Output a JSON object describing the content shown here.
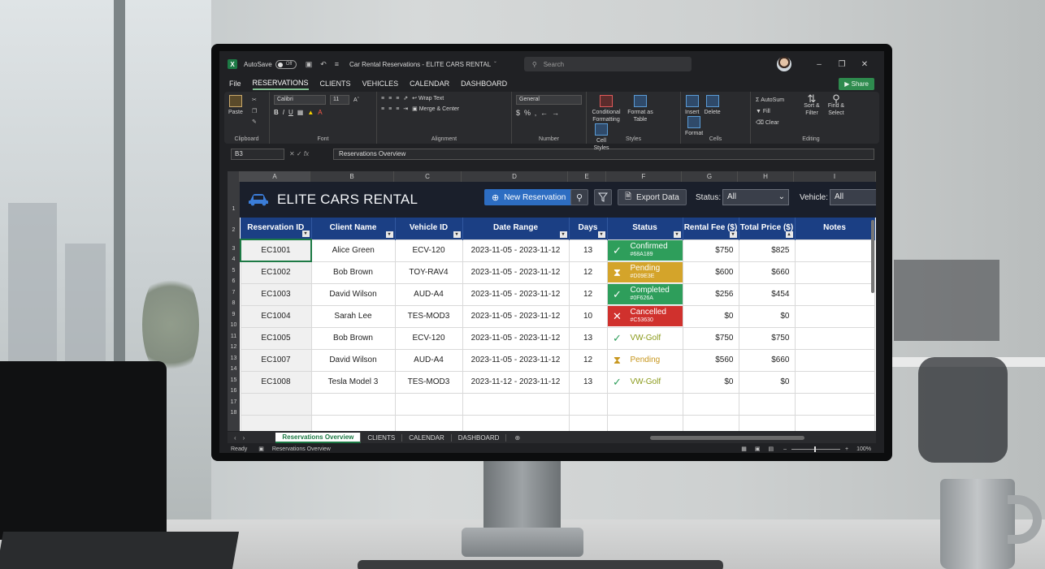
{
  "app": {
    "autosave_label": "AutoSave",
    "autosave_state": "Off",
    "doc_title": "Car Rental Reservations - ELITE CARS RENTAL",
    "search_placeholder": "Search"
  },
  "menu": {
    "tabs": [
      "File",
      "RESERVATIONS",
      "CLIENTS",
      "VEHICLES",
      "CALENDAR",
      "DASHBOARD"
    ],
    "share_label": "Share"
  },
  "ribbon": {
    "clipboard": {
      "paste": "Paste",
      "label": "Clipboard"
    },
    "font": {
      "name": "Calibri",
      "size": "11",
      "label": "Font"
    },
    "alignment": {
      "wrap": "Wrap Text",
      "merge": "Merge & Center",
      "label": "Alignment"
    },
    "number": {
      "format": "General",
      "label": "Number"
    },
    "styles": {
      "conditional": "Conditional Formatting",
      "table": "Format as Table",
      "cell": "Cell Styles",
      "label": "Styles"
    },
    "cells": {
      "insert": "Insert",
      "delete": "Delete",
      "format": "Format",
      "label": "Cells"
    },
    "editing": {
      "autosum": "AutoSum",
      "fill": "Fill",
      "clear": "Clear",
      "sort": "Sort & Filter",
      "find": "Find & Select",
      "label": "Editing"
    }
  },
  "formula_bar": {
    "name_box": "B3",
    "content": "Reservations Overview"
  },
  "grid": {
    "columns": [
      "A",
      "B",
      "C",
      "D",
      "E",
      "F",
      "G",
      "H",
      "I"
    ],
    "row_numbers": [
      "1",
      "2",
      "3",
      "4",
      "5",
      "6",
      "7",
      "8",
      "9",
      "10",
      "11",
      "12",
      "13",
      "14",
      "15",
      "16",
      "17",
      "18"
    ]
  },
  "dashboard": {
    "brand": "ELITE CARS RENTAL",
    "new_reservation": "New Reservation",
    "export_data": "Export Data",
    "status_label": "Status:",
    "status_value": "All",
    "vehicle_label": "Vehicle:",
    "vehicle_value": "All"
  },
  "table": {
    "headers": [
      "Reservation ID",
      "Client Name",
      "Vehicle ID",
      "Date Range",
      "Days",
      "Status",
      "Rental Fee ($)",
      "Total Price ($)",
      "Notes"
    ],
    "rows": [
      {
        "id": "EC1001",
        "client": "Alice Green",
        "vehicle": "ECV-120",
        "dates": "2023-11-05 - 2023-11-12",
        "days": "13",
        "status": "Confirmed",
        "status_sub": "#68A189",
        "fee": "$750",
        "total": "$825"
      },
      {
        "id": "EC1002",
        "client": "Bob Brown",
        "vehicle": "TOY-RAV4",
        "dates": "2023-11-05 - 2023-11-12",
        "days": "12",
        "status": "Pending",
        "status_sub": "#D09E3E",
        "fee": "$600",
        "total": "$660"
      },
      {
        "id": "EC1003",
        "client": "David Wilson",
        "vehicle": "AUD-A4",
        "dates": "2023-11-05 - 2023-11-12",
        "days": "12",
        "status": "Completed",
        "status_sub": "#0F626A",
        "fee": "$256",
        "total": "$454"
      },
      {
        "id": "EC1004",
        "client": "Sarah Lee",
        "vehicle": "TES-MOD3",
        "dates": "2023-11-05 - 2023-11-12",
        "days": "10",
        "status": "Cancelled",
        "status_sub": "#C53630",
        "fee": "$0",
        "total": "$0"
      },
      {
        "id": "EC1005",
        "client": "Bob Brown",
        "vehicle": "ECV-120",
        "dates": "2023-11-05 - 2023-11-12",
        "days": "13",
        "status": "VW-Golf",
        "status_sub": "",
        "fee": "$750",
        "total": "$750"
      },
      {
        "id": "EC1007",
        "client": "David Wilson",
        "vehicle": "AUD-A4",
        "dates": "2023-11-05 - 2023-11-12",
        "days": "12",
        "status": "Pending",
        "status_sub": "",
        "fee": "$560",
        "total": "$660"
      },
      {
        "id": "EC1008",
        "client": "Tesla Model 3",
        "vehicle": "TES-MOD3",
        "dates": "2023-11-12 - 2023-11-12",
        "days": "13",
        "status": "VW-Golf",
        "status_sub": "",
        "fee": "$0",
        "total": "$0"
      }
    ]
  },
  "sheets": [
    "Reservations Overview",
    "CLIENTS",
    "CALENDAR",
    "DASHBOARD"
  ],
  "statusbar": {
    "ready": "Ready",
    "sheet": "Reservations Overview",
    "zoom": "100%"
  },
  "colors": {
    "confirmed": "#2e9e5b",
    "pending": "#d4a42a",
    "completed": "#2e9e5b",
    "cancelled": "#d0312d",
    "header_blue": "#1b3f84",
    "excel_green": "#1d7a45"
  }
}
